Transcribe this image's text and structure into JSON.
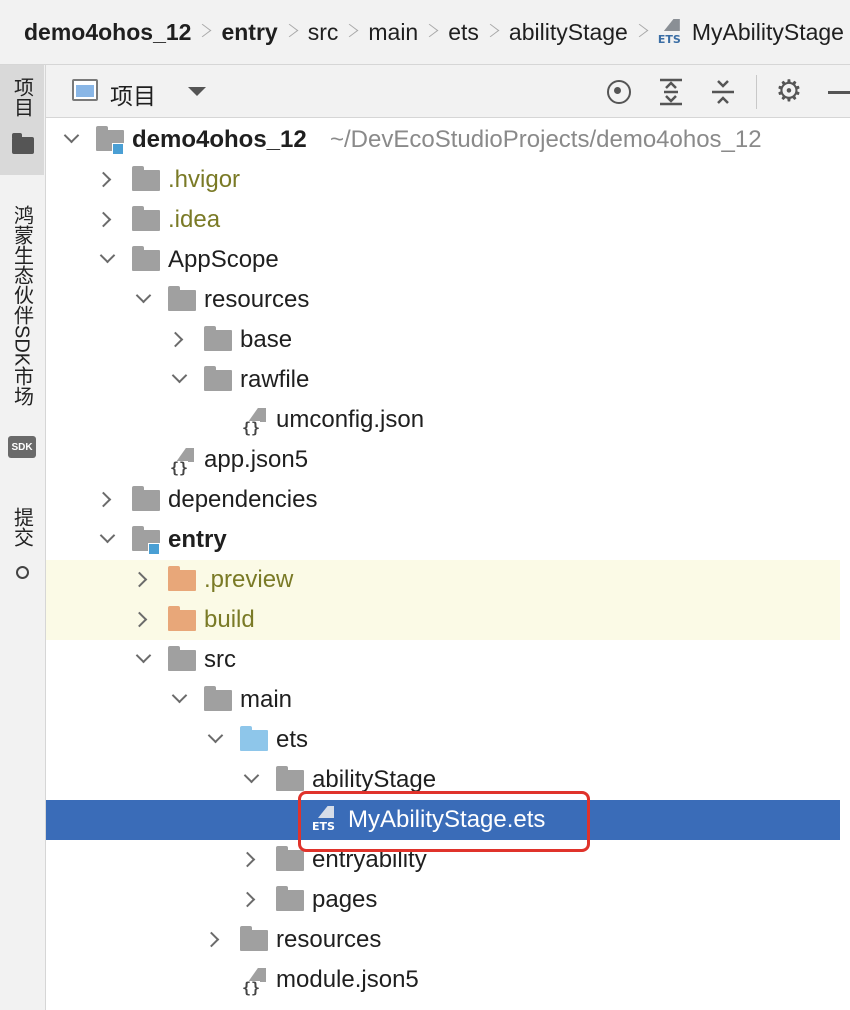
{
  "breadcrumb": {
    "items": [
      "demo4ohos_12",
      "entry",
      "src",
      "main",
      "ets",
      "abilityStage",
      "MyAbilityStage"
    ]
  },
  "side_strip": {
    "tabs": [
      {
        "label": "项目",
        "icon": "folder-icon"
      },
      {
        "label": "鸿蒙生态伙伴SDK市场",
        "icon": "sdk-icon"
      },
      {
        "label": "提交",
        "icon": "commit-icon"
      }
    ],
    "sdk_badge": "SDK"
  },
  "project_panel": {
    "title": "项目",
    "toolbar_icons": [
      "locate-icon",
      "expand-all-icon",
      "collapse-all-icon",
      "gear-icon",
      "hide-icon"
    ]
  },
  "tree": {
    "root_name": "demo4ohos_12",
    "root_path": "~/DevEcoStudioProjects/demo4ohos_12",
    "nodes": {
      "hvigor": ".hvigor",
      "idea": ".idea",
      "appscope": "AppScope",
      "resources": "resources",
      "base": "base",
      "rawfile": "rawfile",
      "umconfig": "umconfig.json",
      "appjson": "app.json5",
      "dependencies": "dependencies",
      "entry": "entry",
      "preview": ".preview",
      "build": "build",
      "src": "src",
      "main": "main",
      "ets": "ets",
      "abilitystage": "abilityStage",
      "myabilitystage": "MyAbilityStage.ets",
      "entryability": "entryability",
      "pages": "pages",
      "resources2": "resources",
      "modulejson": "module.json5"
    },
    "selected": "MyAbilityStage.ets"
  },
  "colors": {
    "selection": "#3a6cb8",
    "excluded_highlight": "#fbfae6",
    "annotation": "#e0332b"
  }
}
